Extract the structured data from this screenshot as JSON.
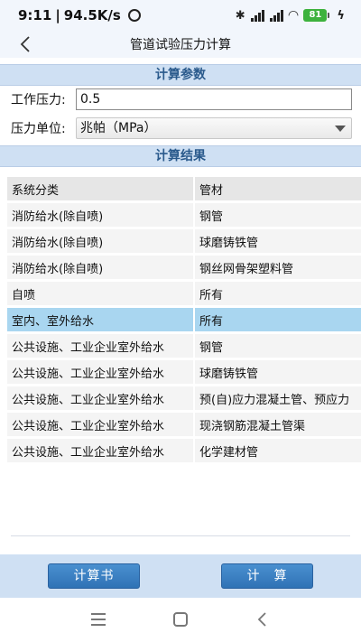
{
  "status_bar": {
    "time": "9:11",
    "net_speed": "94.5K/s",
    "battery_level": "81",
    "icons": [
      "alarm-icon",
      "bluetooth-icon",
      "signal-icon",
      "wifi-icon",
      "battery-icon",
      "charging-icon"
    ]
  },
  "app_bar": {
    "title": "管道试验压力计算",
    "back_icon": "chevron-left-icon"
  },
  "params_section": {
    "title": "计算参数",
    "work_pressure_label": "工作压力:",
    "work_pressure_value": "0.5",
    "unit_label": "压力单位:",
    "unit_value": "兆帕（MPa）"
  },
  "results_section": {
    "title": "计算结果",
    "columns": [
      "系统分类",
      "管材"
    ],
    "rows": [
      [
        "消防给水(除自喷)",
        "钢管"
      ],
      [
        "消防给水(除自喷)",
        "球磨铸铁管"
      ],
      [
        "消防给水(除自喷)",
        "钢丝网骨架塑料管"
      ],
      [
        "自喷",
        "所有"
      ],
      [
        "室内、室外给水",
        "所有"
      ],
      [
        "公共设施、工业企业室外给水",
        "钢管"
      ],
      [
        "公共设施、工业企业室外给水",
        "球磨铸铁管"
      ],
      [
        "公共设施、工业企业室外给水",
        "预(自)应力混凝土管、预应力"
      ],
      [
        "公共设施、工业企业室外给水",
        "现浇钢筋混凝土管渠"
      ],
      [
        "公共设施、工业企业室外给水",
        "化学建材管"
      ]
    ],
    "selected_row_index": 4,
    "selected_color": "#a9d6f0"
  },
  "bottom_bar": {
    "report_button": "计算书",
    "calc_button": "计　算"
  },
  "nav_bar": {
    "icons": [
      "menu-icon",
      "home-icon",
      "back-icon"
    ]
  },
  "colors": {
    "header_bg": "#cfe0f3",
    "section_text": "#2a5a8c",
    "button": "#3a80c4",
    "battery": "#3db23d"
  }
}
